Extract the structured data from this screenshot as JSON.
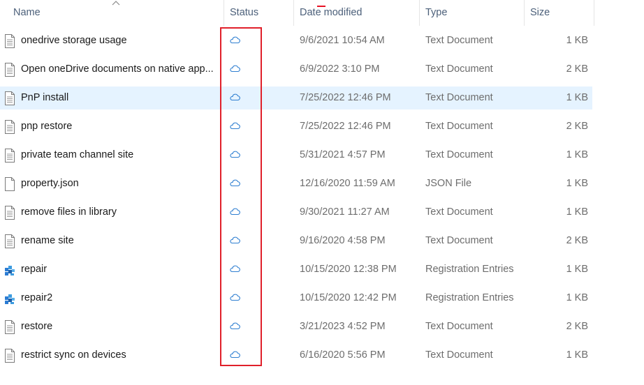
{
  "columns": {
    "name": "Name",
    "status": "Status",
    "date_modified": "Date modified",
    "type": "Type",
    "size": "Size"
  },
  "status_icon": "cloud-icon",
  "highlight_color": "#e0202a",
  "selected_row_color": "#e5f3ff",
  "files": [
    {
      "name": "onedrive storage usage",
      "date": "9/6/2021 10:54 AM",
      "type": "Text Document",
      "size": "1 KB",
      "icon": "text-document-icon"
    },
    {
      "name": "Open oneDrive documents on native app...",
      "date": "6/9/2022 3:10 PM",
      "type": "Text Document",
      "size": "2 KB",
      "icon": "text-document-icon"
    },
    {
      "name": "PnP install",
      "date": "7/25/2022 12:46 PM",
      "type": "Text Document",
      "size": "1 KB",
      "icon": "text-document-icon",
      "selected": true
    },
    {
      "name": "pnp restore",
      "date": "7/25/2022 12:46 PM",
      "type": "Text Document",
      "size": "2 KB",
      "icon": "text-document-icon"
    },
    {
      "name": "private team channel site",
      "date": "5/31/2021 4:57 PM",
      "type": "Text Document",
      "size": "1 KB",
      "icon": "text-document-icon"
    },
    {
      "name": "property.json",
      "date": "12/16/2020 11:59 AM",
      "type": "JSON File",
      "size": "1 KB",
      "icon": "blank-file-icon"
    },
    {
      "name": "remove files in library",
      "date": "9/30/2021 11:27 AM",
      "type": "Text Document",
      "size": "1 KB",
      "icon": "text-document-icon"
    },
    {
      "name": "rename site",
      "date": "9/16/2020 4:58 PM",
      "type": "Text Document",
      "size": "2 KB",
      "icon": "text-document-icon"
    },
    {
      "name": "repair",
      "date": "10/15/2020 12:38 PM",
      "type": "Registration Entries",
      "size": "1 KB",
      "icon": "registry-file-icon"
    },
    {
      "name": "repair2",
      "date": "10/15/2020 12:42 PM",
      "type": "Registration Entries",
      "size": "1 KB",
      "icon": "registry-file-icon"
    },
    {
      "name": "restore",
      "date": "3/21/2023 4:52 PM",
      "type": "Text Document",
      "size": "2 KB",
      "icon": "text-document-icon"
    },
    {
      "name": "restrict sync on devices",
      "date": "6/16/2020 5:56 PM",
      "type": "Text Document",
      "size": "1 KB",
      "icon": "text-document-icon"
    }
  ]
}
